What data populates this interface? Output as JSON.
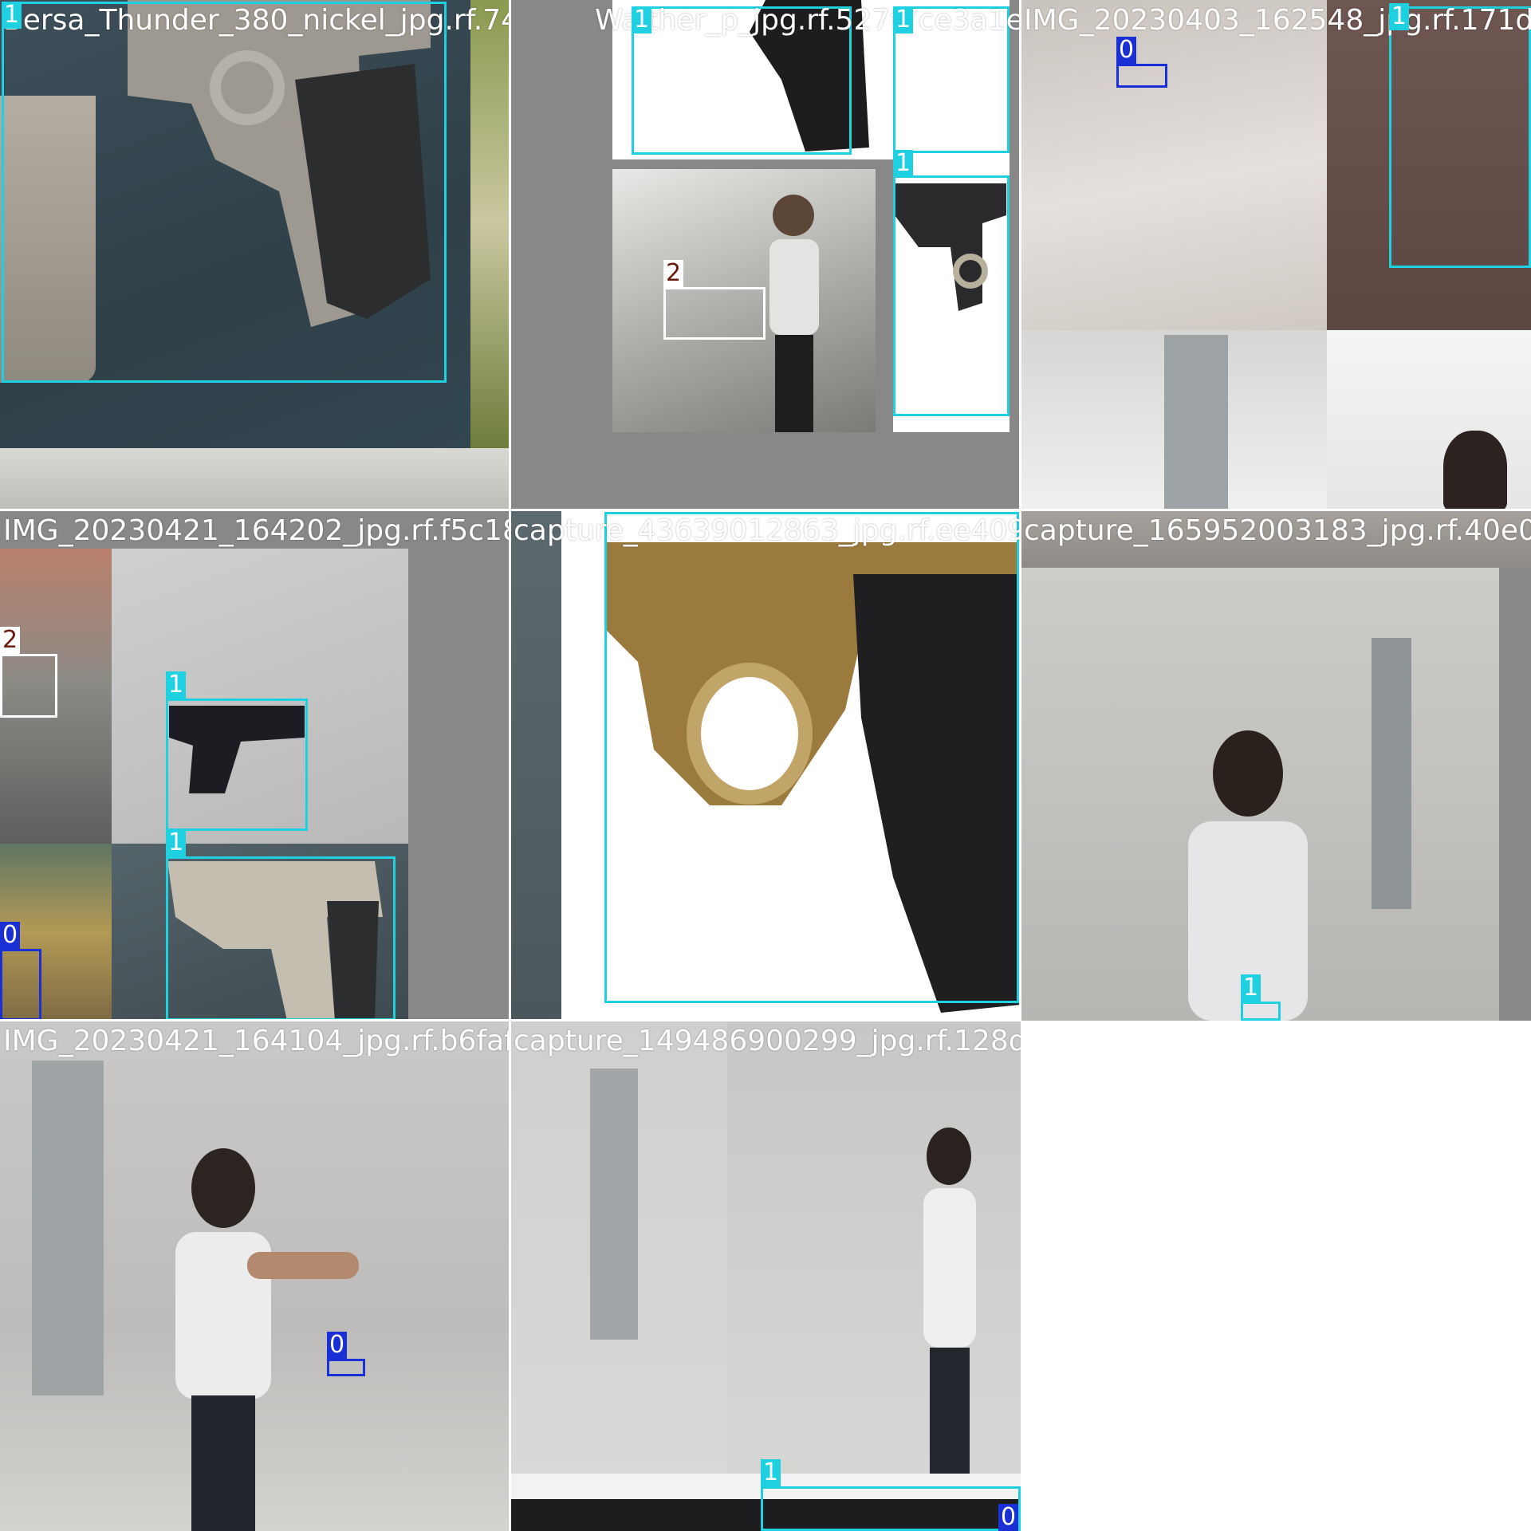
{
  "colors": {
    "class_0": "#1a2fd6",
    "class_1": "#1fd0e0",
    "class_2": "#ffffff",
    "tag_text": "#ffffff",
    "class_2_tag_text": "#6b1a10",
    "pad": "#888888"
  },
  "tiles": [
    {
      "filename": "Bersa_Thunder_380_nickel_jpg.rf.74f7327f",
      "detections": [
        {
          "class": "1"
        }
      ]
    },
    {
      "filename": "Walther_p_jpg.rf.527f7ce3a1ea1358d2af0",
      "detections": [
        {
          "class": "1"
        },
        {
          "class": "1"
        },
        {
          "class": "1"
        },
        {
          "class": "2"
        }
      ]
    },
    {
      "filename": "IMG_20230403_162548_jpg.rf.171d5",
      "detections": [
        {
          "class": "0"
        },
        {
          "class": "1"
        }
      ]
    },
    {
      "filename": "IMG_20230421_164202_jpg.rf.f5c186",
      "detections": [
        {
          "class": "2"
        },
        {
          "class": "1"
        },
        {
          "class": "1"
        },
        {
          "class": "0"
        }
      ]
    },
    {
      "filename": "capture_43639012863_jpg.rf.ee409ade",
      "detections": [
        {
          "class": "1"
        }
      ]
    },
    {
      "filename": "capture_165952003183_jpg.rf.40e03f",
      "detections": [
        {
          "class": "1"
        }
      ]
    },
    {
      "filename": "IMG_20230421_164104_jpg.rf.b6faf2",
      "detections": [
        {
          "class": "0"
        }
      ]
    },
    {
      "filename": "capture_149486900299_jpg.rf.128d0a92c5b7",
      "detections": [
        {
          "class": "0"
        },
        {
          "class": "1"
        }
      ]
    }
  ]
}
